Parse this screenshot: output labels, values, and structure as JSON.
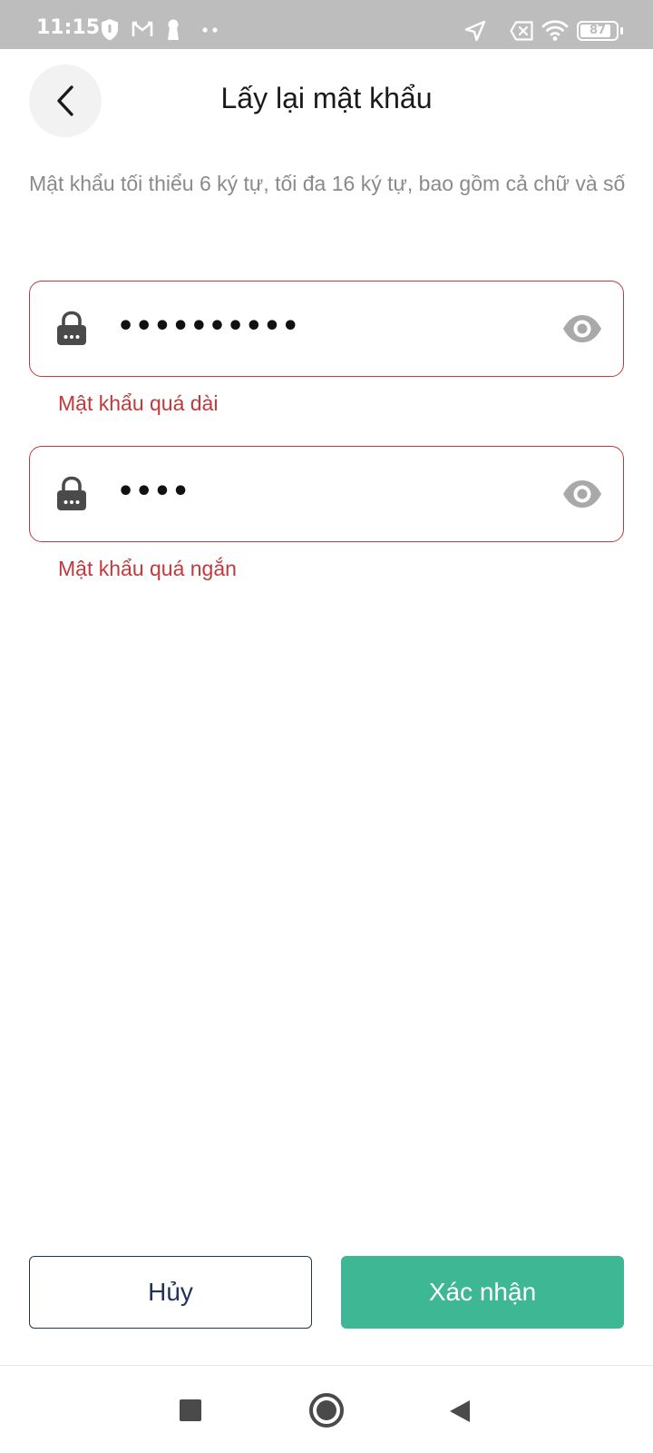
{
  "status_bar": {
    "time": "11:15",
    "battery_level": "87",
    "left_icons": [
      "shield-icon",
      "gmail-icon",
      "keyhole-icon",
      "more-dots-icon"
    ],
    "right_icons": [
      "location-arrow-icon",
      "no-sim-icon",
      "wifi-icon",
      "battery-icon"
    ]
  },
  "header": {
    "title": "Lấy lại mật khẩu",
    "back_icon": "chevron-left-icon"
  },
  "hint": "Mật khẩu tối thiểu 6 ký tự, tối đa 16 ký tự, bao gồm cả chữ và số",
  "fields": [
    {
      "value": "••••••••••",
      "error": "Mật khẩu quá dài",
      "lock_icon": "lock-icon",
      "toggle_icon": "eye-icon"
    },
    {
      "value": "••••",
      "error": "Mật khẩu quá ngắn",
      "lock_icon": "lock-icon",
      "toggle_icon": "eye-icon"
    }
  ],
  "buttons": {
    "cancel": "Hủy",
    "confirm": "Xác nhận"
  },
  "colors": {
    "error": "#c0393b",
    "confirm": "#3eb894",
    "cancel_border": "#1f3558",
    "status_bar": "#bdbdbd"
  },
  "nav_bar": {
    "icons": [
      "recents-square-icon",
      "home-circle-icon",
      "back-triangle-icon"
    ]
  }
}
